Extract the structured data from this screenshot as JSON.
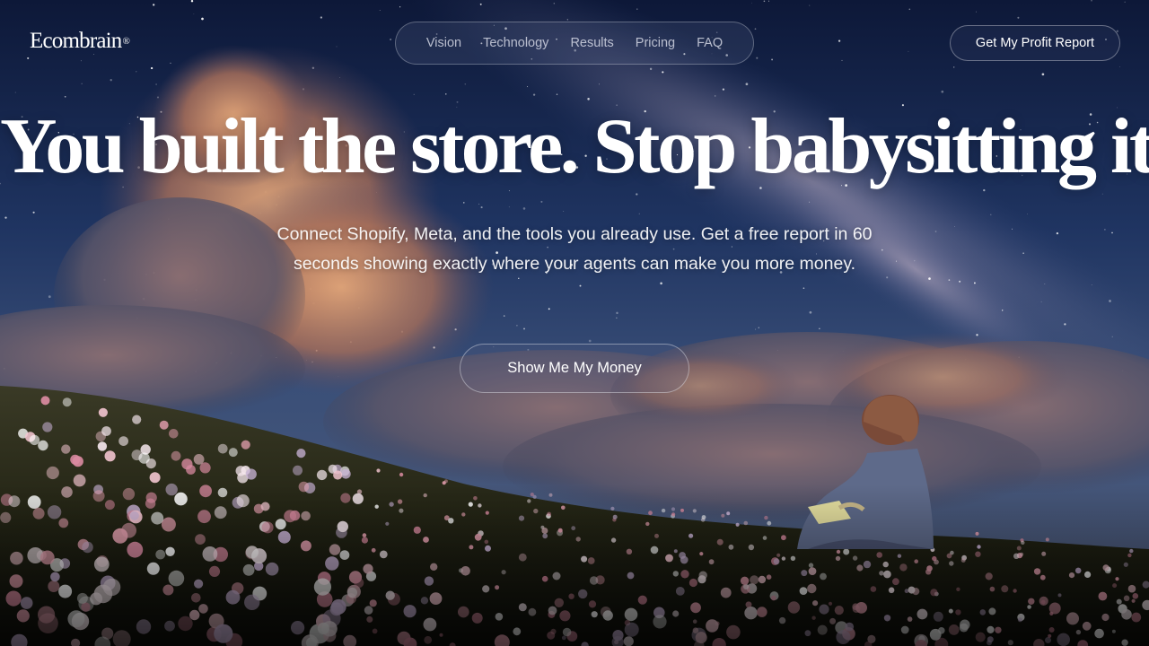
{
  "brand": {
    "name": "Ecombrain",
    "reg_mark": "®"
  },
  "nav": {
    "items": [
      {
        "label": "Vision"
      },
      {
        "label": "Technology"
      },
      {
        "label": "Results"
      },
      {
        "label": "Pricing"
      },
      {
        "label": "FAQ"
      }
    ]
  },
  "header_cta": {
    "label": "Get My Profit Report"
  },
  "hero": {
    "headline": "You built the store. Stop babysitting it.",
    "subheadline": "Connect Shopify, Meta, and the tools you already use. Get a free report in 60 seconds showing exactly where your agents can make you more money.",
    "cta_label": "Show Me My Money"
  },
  "colors": {
    "sky_top": "#0f1a3c",
    "sky_mid": "#27426d",
    "cloud_warm": "#c98862",
    "meadow": "#1f2414",
    "flower_pink": "#e6a0b0"
  }
}
